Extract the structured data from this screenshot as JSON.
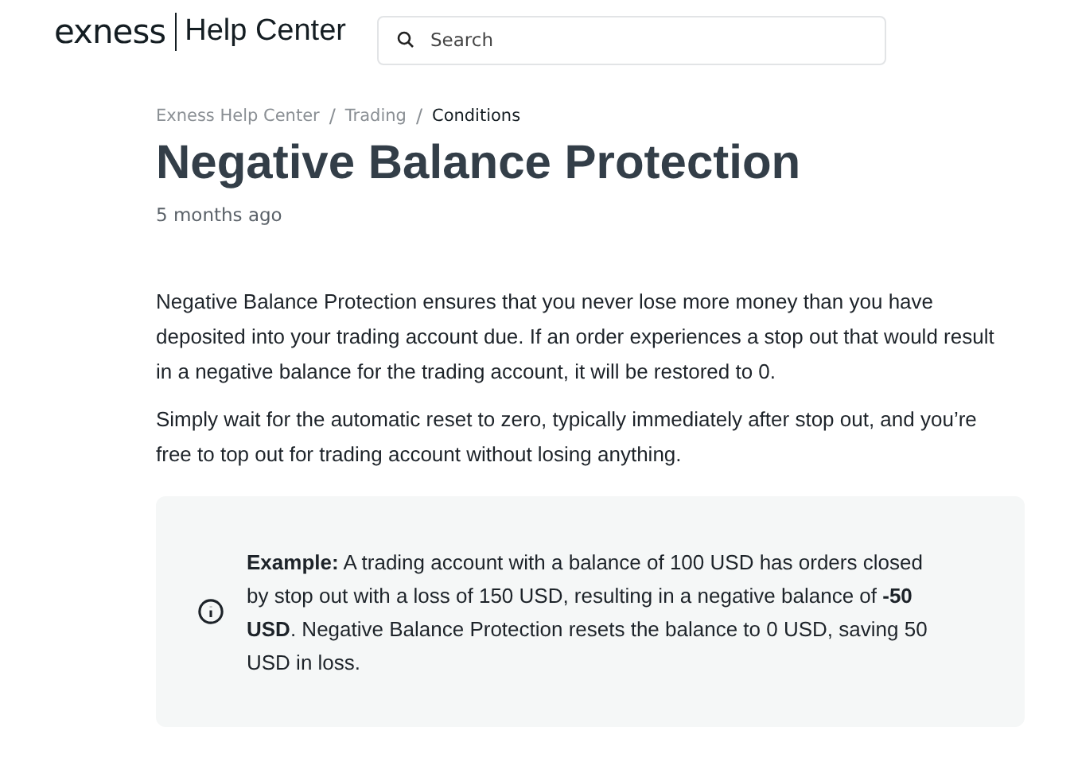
{
  "header": {
    "logo": "exness",
    "title": "Help Center",
    "search": {
      "placeholder": "Search"
    }
  },
  "breadcrumb": {
    "separator": "/",
    "items": [
      {
        "label": "Exness Help Center",
        "current": false
      },
      {
        "label": "Trading",
        "current": false
      },
      {
        "label": "Conditions",
        "current": true
      }
    ]
  },
  "article": {
    "title": "Negative Balance Protection",
    "updated": "5 months ago",
    "paragraphs": [
      "Negative Balance Protection ensures that you never lose more money than you have deposited into your trading account due. If an order experiences a stop out that would result in a negative balance for the trading account, it will be restored to 0.",
      "Simply wait for the automatic reset to zero, typically immediately after stop out, and you’re free to top out for trading account without losing anything."
    ],
    "callout": {
      "kind": "info",
      "text": "**Example:** A trading account with a balance of 100 USD has orders closed by stop out with a loss of 150 USD, resulting in a negative balance of **-50 USD**. Negative Balance Protection resets the balance to 0 USD, saving 50 USD in loss."
    }
  }
}
